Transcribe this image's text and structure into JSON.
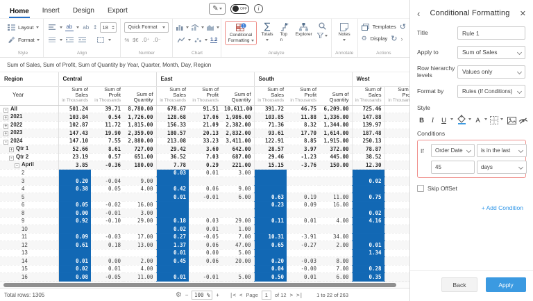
{
  "tabs": [
    {
      "label": "Home",
      "active": true
    },
    {
      "label": "Insert",
      "active": false
    },
    {
      "label": "Design",
      "active": false
    },
    {
      "label": "Export",
      "active": false
    }
  ],
  "topbar": {
    "toggle_label": "OFF"
  },
  "ribbon": {
    "style": {
      "layout": "Layout",
      "format": "Format",
      "label": "Style"
    },
    "align": {
      "font_size": "18",
      "ab": "ab",
      "label": "Align"
    },
    "number": {
      "quick_format": "Quick Format",
      "percent": "%",
      "currency": "$€",
      "inc": ".0⁺",
      "dec": ".0⁻",
      "label": "Number"
    },
    "chart": {
      "one_two": "1.2",
      "label": "Chart"
    },
    "analyze": {
      "cf1": "Conditional",
      "cf2": "Formatting",
      "badge": "1",
      "totals": "Totals",
      "topn": "Top n",
      "explorer": "Explorer",
      "label": "Analyze"
    },
    "annotate": {
      "notes": "Notes",
      "label": "Annotate"
    },
    "actions": {
      "templates": "Templates",
      "display": "Display",
      "label": "Actions"
    }
  },
  "report_title": "Sum of Sales, Sum of Profit, Sum of Quantity by Year, Quarter, Month, Day, Region",
  "table": {
    "corner_top": "Region",
    "corner_bottom": "Year",
    "groups": [
      "Central",
      "East",
      "South",
      "West"
    ],
    "measures": [
      {
        "t": "Sum of Sales",
        "s": "in Thousands"
      },
      {
        "t": "Sum of Profit",
        "s": "in Thousands"
      },
      {
        "t": "Sum of Quantity",
        "s": ""
      }
    ],
    "partial_header": {
      "t": "Sum of Profit",
      "s": "in Thousands"
    },
    "sales_col_indices": [
      0,
      3,
      6,
      9
    ],
    "highlight_color": "#1268b4",
    "rows": [
      {
        "label": "All",
        "level": 0,
        "expand": "-",
        "agg": true,
        "values": [
          "501.24",
          "39.71",
          "8,780.00",
          "678.67",
          "91.51",
          "10,611.00",
          "391.72",
          "46.75",
          "6,209.00",
          "725.46"
        ]
      },
      {
        "label": "2021",
        "level": 0,
        "expand": "+",
        "agg": true,
        "values": [
          "103.84",
          "0.54",
          "1,726.00",
          "128.68",
          "17.06",
          "1,986.00",
          "103.85",
          "11.88",
          "1,336.00",
          "147.88"
        ]
      },
      {
        "label": "2022",
        "level": 0,
        "expand": "+",
        "agg": true,
        "values": [
          "102.87",
          "11.72",
          "1,815.00",
          "156.33",
          "21.09",
          "2,382.00",
          "71.36",
          "8.32",
          "1,344.00",
          "139.97"
        ]
      },
      {
        "label": "2023",
        "level": 0,
        "expand": "+",
        "agg": true,
        "values": [
          "147.43",
          "19.90",
          "2,359.00",
          "180.57",
          "20.13",
          "2,832.00",
          "93.61",
          "17.70",
          "1,614.00",
          "187.48"
        ]
      },
      {
        "label": "2024",
        "level": 0,
        "expand": "-",
        "agg": true,
        "values": [
          "147.10",
          "7.55",
          "2,880.00",
          "213.08",
          "33.23",
          "3,411.00",
          "122.91",
          "8.85",
          "1,915.00",
          "250.13"
        ]
      },
      {
        "label": "Qtr 1",
        "level": 1,
        "expand": "+",
        "agg": true,
        "values": [
          "52.66",
          "8.61",
          "727.00",
          "29.42",
          "3.60",
          "642.00",
          "28.57",
          "3.97",
          "372.00",
          "78.87"
        ]
      },
      {
        "label": "Qtr 2",
        "level": 1,
        "expand": "-",
        "agg": true,
        "values": [
          "23.19",
          "0.57",
          "651.00",
          "36.52",
          "7.03",
          "687.00",
          "29.46",
          "-1.23",
          "445.00",
          "38.52"
        ]
      },
      {
        "label": "April",
        "level": 2,
        "expand": "-",
        "agg": true,
        "values": [
          "3.85",
          "-0.36",
          "180.00",
          "7.78",
          "0.29",
          "221.00",
          "15.15",
          "-3.76",
          "150.00",
          "12.30"
        ]
      },
      {
        "label": "2",
        "level": 3,
        "expand": "",
        "agg": false,
        "values": [
          "",
          "",
          "",
          "0.03",
          "0.01",
          "3.00",
          "",
          "",
          "",
          ""
        ]
      },
      {
        "label": "3",
        "level": 3,
        "expand": "",
        "agg": false,
        "values": [
          "0.20",
          "-0.04",
          "9.00",
          "",
          "",
          "",
          "",
          "",
          "",
          "0.02"
        ]
      },
      {
        "label": "4",
        "level": 3,
        "expand": "",
        "agg": false,
        "values": [
          "0.38",
          "0.05",
          "4.00",
          "0.42",
          "0.06",
          "9.00",
          "",
          "",
          "",
          ""
        ]
      },
      {
        "label": "5",
        "level": 3,
        "expand": "",
        "agg": false,
        "values": [
          "",
          "",
          "",
          "0.01",
          "-0.01",
          "6.00",
          "0.63",
          "0.19",
          "11.00",
          "0.75"
        ]
      },
      {
        "label": "6",
        "level": 3,
        "expand": "",
        "agg": false,
        "values": [
          "0.05",
          "-0.02",
          "16.00",
          "",
          "",
          "",
          "0.23",
          "0.09",
          "16.00",
          ""
        ]
      },
      {
        "label": "8",
        "level": 3,
        "expand": "",
        "agg": false,
        "values": [
          "0.00",
          "-0.01",
          "3.00",
          "",
          "",
          "",
          "",
          "",
          "",
          "0.02"
        ]
      },
      {
        "label": "9",
        "level": 3,
        "expand": "",
        "agg": false,
        "values": [
          "0.92",
          "-0.10",
          "29.00",
          "0.18",
          "0.03",
          "29.00",
          "0.11",
          "0.01",
          "4.00",
          "4.16"
        ]
      },
      {
        "label": "10",
        "level": 3,
        "expand": "",
        "agg": false,
        "values": [
          "",
          "",
          "",
          "0.02",
          "0.01",
          "1.00",
          "",
          "",
          "",
          ""
        ]
      },
      {
        "label": "11",
        "level": 3,
        "expand": "",
        "agg": false,
        "values": [
          "0.09",
          "-0.03",
          "17.00",
          "0.27",
          "-0.05",
          "7.00",
          "10.31",
          "-3.91",
          "34.00",
          ""
        ]
      },
      {
        "label": "12",
        "level": 3,
        "expand": "",
        "agg": false,
        "values": [
          "0.61",
          "0.18",
          "13.00",
          "1.37",
          "0.06",
          "47.00",
          "0.65",
          "-0.27",
          "2.00",
          "0.01"
        ]
      },
      {
        "label": "13",
        "level": 3,
        "expand": "",
        "agg": false,
        "values": [
          "",
          "",
          "",
          "0.01",
          "0.00",
          "5.00",
          "",
          "",
          "",
          "1.34"
        ]
      },
      {
        "label": "14",
        "level": 3,
        "expand": "",
        "agg": false,
        "values": [
          "0.01",
          "0.00",
          "2.00",
          "0.45",
          "0.06",
          "20.00",
          "0.20",
          "-0.03",
          "8.00",
          ""
        ]
      },
      {
        "label": "15",
        "level": 3,
        "expand": "",
        "agg": false,
        "values": [
          "0.02",
          "0.01",
          "4.00",
          "",
          "",
          "",
          "0.04",
          "-0.00",
          "7.00",
          "0.28"
        ]
      },
      {
        "label": "16",
        "level": 3,
        "expand": "",
        "agg": false,
        "values": [
          "0.08",
          "-0.05",
          "11.00",
          "0.01",
          "-0.01",
          "5.00",
          "0.50",
          "0.01",
          "6.00",
          "0.35"
        ]
      }
    ]
  },
  "statusbar": {
    "total_rows": "Total rows: 1305",
    "zoom_out": "−",
    "zoom": "100 %",
    "zoom_in": "+",
    "first": "|<",
    "prev": "<",
    "page_label": "Page",
    "page_value": "1",
    "page_total": "of 12",
    "next": ">",
    "last": ">|",
    "range": "1 to 22 of 263"
  },
  "panel": {
    "title": "Conditional Formatting",
    "title_label": "Title",
    "title_value": "Rule 1",
    "apply_label": "Apply to",
    "apply_value": "Sum of Sales",
    "levels_label": "Row hierarchy levels",
    "levels_value": "Values only",
    "format_label": "Format by",
    "format_value": "Rules (If Conditions)",
    "style_label": "Style",
    "bold": "B",
    "italic": "I",
    "underline": "U",
    "fontcolor": "A",
    "conditions_label": "Conditions",
    "if_label": "If",
    "condition_field": "Order Date",
    "condition_operator": "is in the last",
    "condition_value": "45",
    "condition_unit": "days",
    "skip_label": "Skip OffSet",
    "add_condition": "+ Add Condition",
    "back": "Back",
    "apply": "Apply",
    "accent_red": "#f0908c",
    "accent_blue": "#3b9ae1",
    "link_blue": "#2f96e8"
  }
}
